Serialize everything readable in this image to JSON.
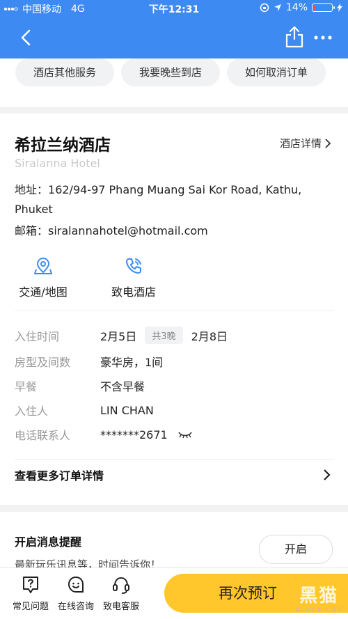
{
  "status_bar": {
    "carrier": "中国移动",
    "network": "4G",
    "time": "下午12:31",
    "battery_percent": "14%",
    "battery_level": 0.14
  },
  "service_chips": [
    "酒店其他服务",
    "我要晚些到店",
    "如何取消订单"
  ],
  "hotel": {
    "name": "希拉兰纳酒店",
    "name_en": "Siralanna Hotel",
    "detail_link": "酒店详情",
    "address_label": "地址：",
    "address": "162/94-97 Phang Muang Sai Kor Road, Kathu, Phuket",
    "email_label": "邮箱：",
    "email": "siralannahotel@hotmail.com"
  },
  "actions": {
    "map_label": "交通/地图",
    "call_label": "致电酒店"
  },
  "booking": {
    "checkin_label": "入住时间",
    "checkin_date": "2月5日",
    "nights": "共3晚",
    "checkout_date": "2月8日",
    "room_label": "房型及间数",
    "room_value": "豪华房，1间",
    "breakfast_label": "早餐",
    "breakfast_value": "不含早餐",
    "guest_label": "入住人",
    "guest_value": "LIN CHAN",
    "phone_label": "电话联系人",
    "phone_value": "*******2671"
  },
  "more_details": "查看更多订单详情",
  "notification": {
    "title": "开启消息提醒",
    "subtitle": "最新玩乐讯息等，时间告诉你！",
    "button": "开启"
  },
  "bottom_bar": {
    "faq": "常见问题",
    "online": "在线咨询",
    "call_service": "致电客服",
    "rebook": "再次预订"
  },
  "watermark": {
    "cn": "黑猫",
    "en": "BLACK CAT"
  },
  "colors": {
    "primary": "#3d8bf2",
    "rebook": "#ffc72c"
  }
}
